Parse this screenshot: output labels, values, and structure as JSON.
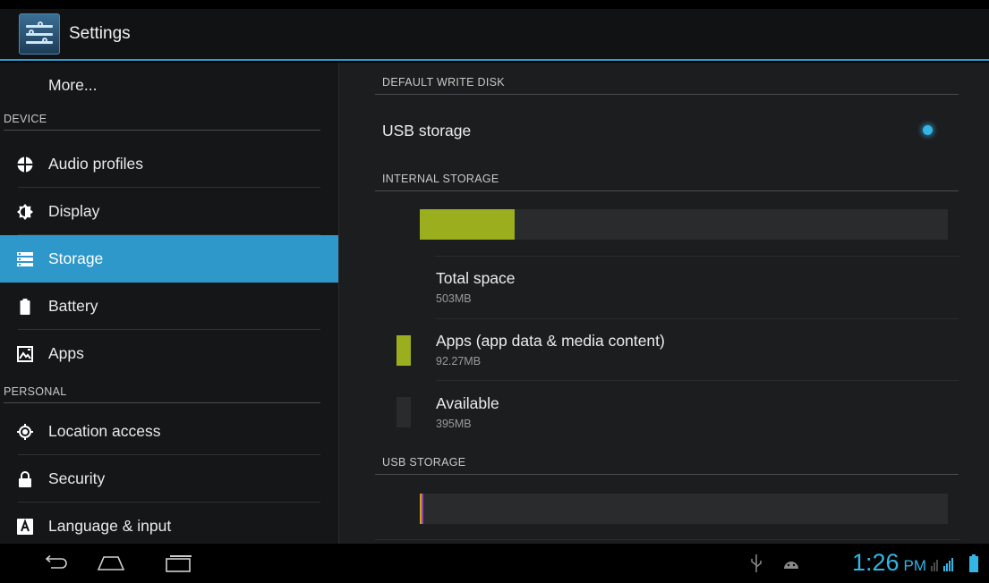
{
  "app": {
    "title": "Settings",
    "icon": "settings-sliders-icon"
  },
  "sidebar": {
    "more_label": "More...",
    "device_header": "DEVICE",
    "personal_header": "PERSONAL",
    "items": [
      {
        "label": "Audio profiles",
        "icon": "audio-profiles-icon"
      },
      {
        "label": "Display",
        "icon": "brightness-icon"
      },
      {
        "label": "Storage",
        "icon": "storage-icon"
      },
      {
        "label": "Battery",
        "icon": "battery-icon"
      },
      {
        "label": "Apps",
        "icon": "apps-icon"
      },
      {
        "label": "Location access",
        "icon": "location-icon"
      },
      {
        "label": "Security",
        "icon": "lock-icon"
      },
      {
        "label": "Language & input",
        "icon": "language-icon"
      }
    ],
    "active_item": "Storage"
  },
  "detail": {
    "default_write_disk_header": "DEFAULT WRITE DISK",
    "usb_storage_option": "USB storage",
    "usb_storage_selected": true,
    "internal_storage_header": "INTERNAL STORAGE",
    "internal_usage_fraction": 0.18,
    "total_space_label": "Total space",
    "total_space_value": "503MB",
    "apps_label": "Apps (app data & media content)",
    "apps_value": "92.27MB",
    "available_label": "Available",
    "available_value": "395MB",
    "usb_storage_header": "USB STORAGE",
    "usb_usage_fraction": 0.005,
    "colors": {
      "apps": "#9aae1e",
      "available": "#2a2b2d",
      "accent": "#33b5e5",
      "usb_segment_a": "#d0a020",
      "usb_segment_b": "#8e44ad"
    }
  },
  "navbar": {
    "back_icon": "back-icon",
    "home_icon": "home-icon",
    "recents_icon": "recent-apps-icon",
    "usb_icon": "usb-icon",
    "android_debug_icon": "android-debug-icon",
    "time": "1:26",
    "ampm": "PM",
    "signal_icon": "signal-icon",
    "battery_icon": "battery-status-icon"
  }
}
